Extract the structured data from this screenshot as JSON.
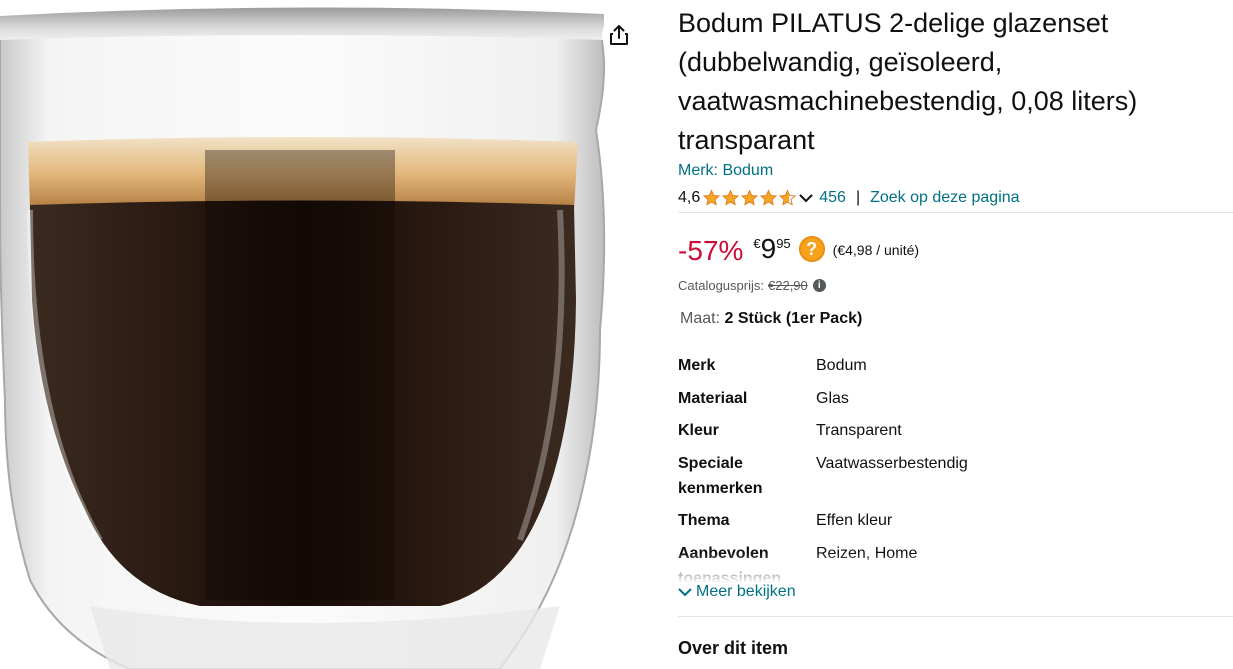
{
  "product": {
    "title": "Bodum PILATUS 2-delige glazenset (dubbelwandig, geïsoleerd, vaatwasmachinebestendig, 0,08 liters) transparant",
    "brand_link": "Merk: Bodum",
    "rating": "4,6",
    "rating_value": 4.6,
    "review_count": "456",
    "separator": "|",
    "search_link": "Zoek op deze pagina",
    "discount": "-57%",
    "currency": "€",
    "price_whole": "9",
    "price_fraction": "95",
    "unit_price": "(€4,98 / unité)",
    "list_price_label": "Catalogusprijs:",
    "list_price": "€22,90",
    "size_label": "Maat:",
    "size_value": "2 Stück (1er Pack)",
    "specs": [
      {
        "k": "Merk",
        "v": "Bodum"
      },
      {
        "k": "Materiaal",
        "v": "Glas"
      },
      {
        "k": "Kleur",
        "v": "Transparent"
      },
      {
        "k": "Speciale kenmerken",
        "v": "Vaatwasserbestendig"
      },
      {
        "k": "Thema",
        "v": "Effen kleur"
      },
      {
        "k": "Aanbevolen toepassingen",
        "v": "Reizen, Home"
      }
    ],
    "more_link": "Meer bekijken",
    "about_heading": "Over dit item"
  },
  "colors": {
    "link": "#007185",
    "discount": "#cc0c39",
    "star": "#f5a623",
    "badge": "#f7a21b"
  },
  "icons": [
    "share-icon",
    "star-icon",
    "chevron-down-icon",
    "question-icon",
    "info-icon"
  ]
}
